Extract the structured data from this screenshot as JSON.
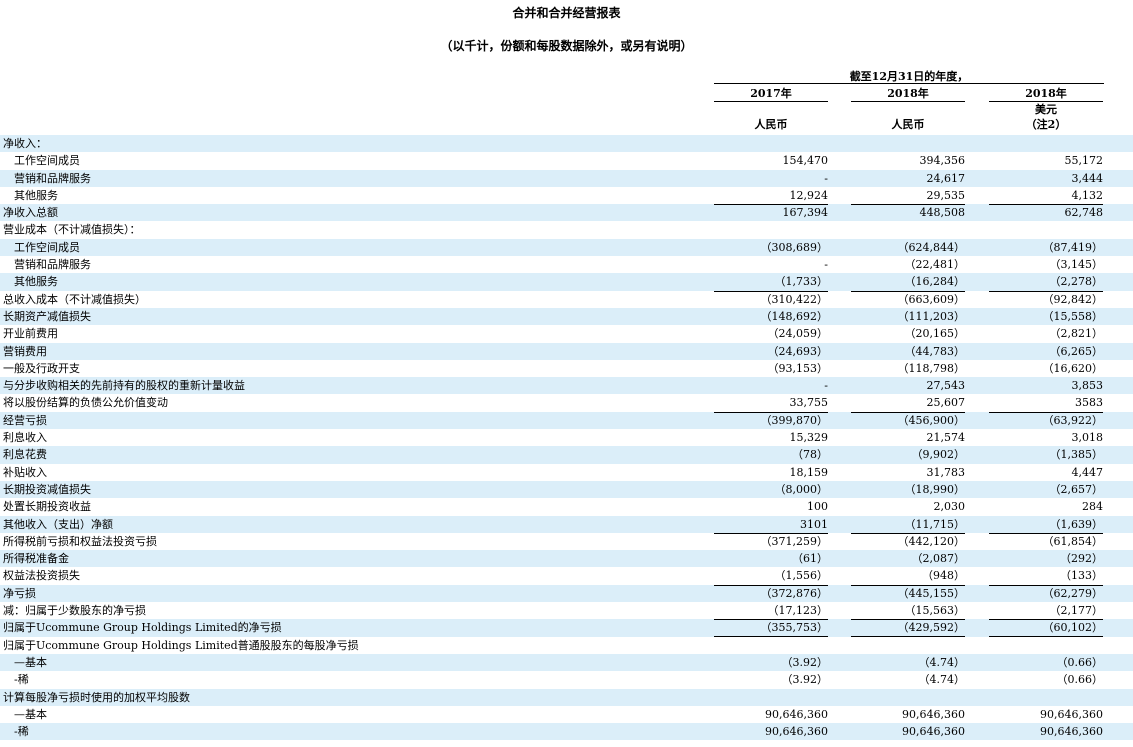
{
  "title": "合并和合并经营报表",
  "subtitle": "（以千计，份额和每股数据除外，或另有说明）",
  "period": "截至12月31日的年度，",
  "columns": [
    {
      "year": "2017年",
      "sub": "",
      "currency": "人民币"
    },
    {
      "year": "2018年",
      "sub": "",
      "currency": "人民币"
    },
    {
      "year": "2018年",
      "sub": "美元",
      "currency": "（注2）"
    }
  ],
  "rows": [
    {
      "label": "净收入：",
      "indent": false,
      "values": [
        "",
        "",
        ""
      ]
    },
    {
      "label": "工作空间成员",
      "indent": true,
      "values": [
        "154,470",
        "394,356",
        "55,172"
      ]
    },
    {
      "label": "营销和品牌服务",
      "indent": true,
      "values": [
        "-",
        "24,617",
        "3,444"
      ]
    },
    {
      "label": "其他服务",
      "indent": true,
      "values": [
        "12,924",
        "29,535",
        "4,132"
      ]
    },
    {
      "label": "净收入总额",
      "indent": false,
      "values": [
        "167,394",
        "448,508",
        "62,748"
      ],
      "topline": true
    },
    {
      "label": "营业成本（不计减值损失）：",
      "indent": false,
      "values": [
        "",
        "",
        ""
      ]
    },
    {
      "label": "工作空间成员",
      "indent": true,
      "values": [
        "（308,689）",
        "（624,844）",
        "（87,419）"
      ]
    },
    {
      "label": "营销和品牌服务",
      "indent": true,
      "values": [
        "-",
        "（22,481）",
        "（3,145）"
      ]
    },
    {
      "label": "其他服务",
      "indent": true,
      "values": [
        "（1,733）",
        "（16,284）",
        "（2,278）"
      ]
    },
    {
      "label": "总收入成本（不计减值损失）",
      "indent": false,
      "values": [
        "（310,422）",
        "（663,609）",
        "（92,842）"
      ],
      "topline": true
    },
    {
      "label": "长期资产减值损失",
      "indent": false,
      "values": [
        "（148,692）",
        "（111,203）",
        "（15,558）"
      ]
    },
    {
      "label": "开业前费用",
      "indent": false,
      "values": [
        "（24,059）",
        "（20,165）",
        "（2,821）"
      ]
    },
    {
      "label": "营销费用",
      "indent": false,
      "values": [
        "（24,693）",
        "（44,783）",
        "（6,265）"
      ]
    },
    {
      "label": "一般及行政开支",
      "indent": false,
      "values": [
        "（93,153）",
        "（118,798）",
        "（16,620）"
      ]
    },
    {
      "label": "与分步收购相关的先前持有的股权的重新计量收益",
      "indent": false,
      "values": [
        "-",
        "27,543",
        "3,853"
      ]
    },
    {
      "label": "将以股份结算的负债公允价值变动",
      "indent": false,
      "values": [
        "33,755",
        "25,607",
        "3583"
      ]
    },
    {
      "label": "经营亏损",
      "indent": false,
      "values": [
        "（399,870）",
        "（456,900）",
        "（63,922）"
      ],
      "topline": true
    },
    {
      "label": "利息收入",
      "indent": false,
      "values": [
        "15,329",
        "21,574",
        "3,018"
      ]
    },
    {
      "label": "利息花费",
      "indent": false,
      "values": [
        "（78）",
        "（9,902）",
        "（1,385）"
      ]
    },
    {
      "label": "补贴收入",
      "indent": false,
      "values": [
        "18,159",
        "31,783",
        "4,447"
      ]
    },
    {
      "label": "长期投资减值损失",
      "indent": false,
      "values": [
        "（8,000）",
        "（18,990）",
        "（2,657）"
      ]
    },
    {
      "label": "处置长期投资收益",
      "indent": false,
      "values": [
        "100",
        "2,030",
        "284"
      ]
    },
    {
      "label": "其他收入（支出）净额",
      "indent": false,
      "values": [
        "3101",
        "（11,715）",
        "（1,639）"
      ]
    },
    {
      "label": "所得税前亏损和权益法投资亏损",
      "indent": false,
      "values": [
        "（371,259）",
        "（442,120）",
        "（61,854）"
      ],
      "topline": true
    },
    {
      "label": "所得税准备金",
      "indent": false,
      "values": [
        "（61）",
        "（2,087）",
        "（292）"
      ]
    },
    {
      "label": "权益法投资损失",
      "indent": false,
      "values": [
        "（1,556）",
        "（948）",
        "（133）"
      ]
    },
    {
      "label": "净亏损",
      "indent": false,
      "values": [
        "（372,876）",
        "（445,155）",
        "（62,279）"
      ],
      "topline": true
    },
    {
      "label": "减：归属于少数股东的净亏损",
      "indent": false,
      "values": [
        "（17,123）",
        "（15,563）",
        "（2,177）"
      ]
    },
    {
      "label": "归属于Ucommune Group Holdings Limited的净亏损",
      "indent": false,
      "values": [
        "（355,753）",
        "（429,592）",
        "（60,102）"
      ],
      "topline": true,
      "bottomline": true
    },
    {
      "label": "归属于Ucommune Group Holdings Limited普通股股东的每股净亏损",
      "indent": false,
      "values": [
        "",
        "",
        ""
      ]
    },
    {
      "label": "—基本",
      "indent": true,
      "values": [
        "（3.92）",
        "（4.74）",
        "（0.66）"
      ]
    },
    {
      "label": "-稀",
      "indent": true,
      "values": [
        "（3.92）",
        "（4.74）",
        "（0.66）"
      ]
    },
    {
      "label": "计算每股净亏损时使用的加权平均股数",
      "indent": false,
      "values": [
        "",
        "",
        ""
      ]
    },
    {
      "label": "—基本",
      "indent": true,
      "values": [
        "90,646,360",
        "90,646,360",
        "90,646,360"
      ]
    },
    {
      "label": "-稀",
      "indent": true,
      "values": [
        "90,646,360",
        "90,646,360",
        "90,646,360"
      ]
    }
  ],
  "colors": {
    "shade": "#dbeef9"
  }
}
